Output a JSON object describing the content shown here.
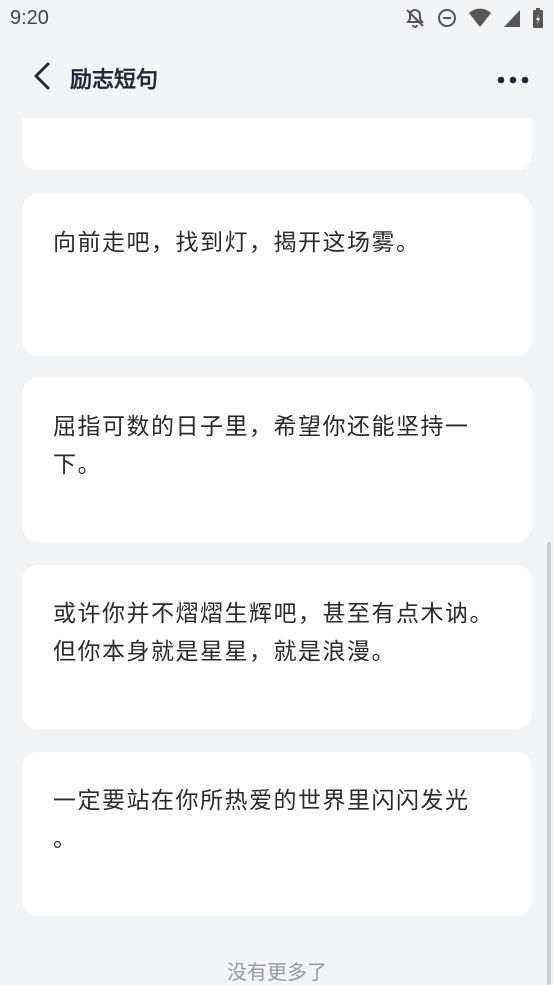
{
  "status_bar": {
    "time": "9:20",
    "icons": [
      "notifications-off-icon",
      "do-not-disturb-icon",
      "wifi-icon",
      "signal-icon",
      "battery-icon"
    ]
  },
  "app_bar": {
    "title": "励志短句",
    "back_icon": "back-arrow-icon",
    "more_icon": "more-dots-icon"
  },
  "quotes": [
    {
      "text": ""
    },
    {
      "text": "向前走吧，找到灯，揭开这场雾。"
    },
    {
      "text": "屈指可数的日子里，希望你还能坚持一下。"
    },
    {
      "text": "或许你并不熠熠生辉吧，甚至有点木讷。但你本身就是星星，就是浪漫。"
    },
    {
      "text": "一定要站在你所热爱的世界里闪闪发光 。"
    }
  ],
  "footer": {
    "text": "没有更多了"
  }
}
